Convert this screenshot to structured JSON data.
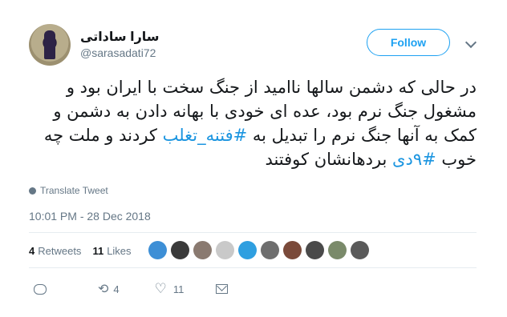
{
  "user": {
    "name": "سارا ساداتی",
    "handle": "@sarasadati72"
  },
  "follow_label": "Follow",
  "tweet": {
    "text_part1": "در حالی که دشمن سالها ناامید از جنگ سخت با ایران بود و مشغول جنگ نرم بود، عده ای خودی با بهانه دادن به دشمن و کمک به آنها جنگ نرم را تبدیل به ",
    "hashtag1": "#فتنه_تغلب",
    "text_part2": " کردند و ملت چه خوب ",
    "hashtag2": "#۹دی",
    "text_part3": " بردهانشان کوفتند"
  },
  "translate_label": "Translate Tweet",
  "timestamp": "10:01 PM - 28 Dec 2018",
  "stats": {
    "retweets_count": "4",
    "retweets_label": "Retweets",
    "likes_count": "11",
    "likes_label": "Likes"
  },
  "likers": [
    "#3d8fd6",
    "#3a3a3a",
    "#8a7a70",
    "#c9c9c9",
    "#2f9fe0",
    "#6e6e6e",
    "#7a4a3a",
    "#4a4a4a",
    "#7a8a6a",
    "#5a5a5a"
  ],
  "actions": {
    "retweet_count": "4",
    "like_count": "11"
  }
}
